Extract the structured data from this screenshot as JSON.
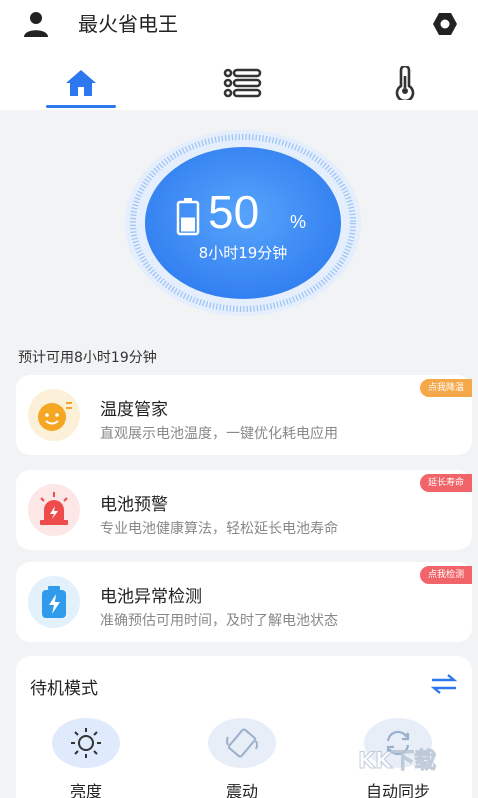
{
  "header": {
    "title": "最火省电王",
    "user_icon": "user-icon",
    "settings_icon": "gear-icon"
  },
  "tabs": [
    {
      "name": "home",
      "icon": "home-icon",
      "active": true
    },
    {
      "name": "list",
      "icon": "list-icon",
      "active": false
    },
    {
      "name": "temperature",
      "icon": "thermometer-icon",
      "active": false
    }
  ],
  "battery": {
    "percent": "50",
    "percent_unit": "%",
    "remaining": "8小时19分钟",
    "level": 0.5
  },
  "estimate_text": "预计可用8小时19分钟",
  "cards": [
    {
      "title": "温度管家",
      "desc": "直观展示电池温度，一键优化耗电应用",
      "tag": "点我降温",
      "icon": "thermometer-face-icon",
      "tag_color": "#f5a84a"
    },
    {
      "title": "电池预警",
      "desc": "专业电池健康算法，轻松延长电池寿命",
      "tag": "延长寿命",
      "icon": "alarm-light-icon",
      "tag_color": "#f0646a"
    },
    {
      "title": "电池异常检测",
      "desc": "准确预估可用时间，及时了解电池状态",
      "tag": "点我检测",
      "icon": "battery-bolt-icon",
      "tag_color": "#f0646a"
    }
  ],
  "standby": {
    "title": "待机模式",
    "modes": [
      {
        "label": "亮度",
        "icon": "brightness-icon"
      },
      {
        "label": "震动",
        "icon": "vibrate-icon"
      },
      {
        "label": "自动同步",
        "icon": "sync-icon"
      }
    ]
  },
  "watermark": "KK下载",
  "colors": {
    "accent": "#2d78ef",
    "gauge_blue": "#3f8df5",
    "tag_orange": "#f5a84a",
    "tag_red": "#f0646a"
  }
}
